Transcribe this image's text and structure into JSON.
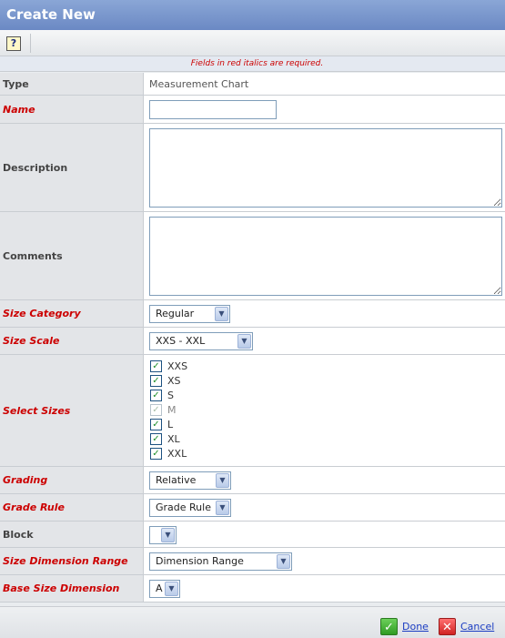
{
  "window": {
    "title": "Create New"
  },
  "toolbar": {
    "help_label": "?",
    "help_icon": "help-icon"
  },
  "required_note": "Fields in red italics are required.",
  "form": {
    "type": {
      "label": "Type",
      "value": "Measurement Chart"
    },
    "name": {
      "label": "Name",
      "value": ""
    },
    "description": {
      "label": "Description",
      "value": ""
    },
    "comments": {
      "label": "Comments",
      "value": ""
    },
    "size_category": {
      "label": "Size Category",
      "value": "Regular"
    },
    "size_scale": {
      "label": "Size Scale",
      "value": "XXS - XXL"
    },
    "select_sizes": {
      "label": "Select Sizes",
      "options": [
        {
          "label": "XXS",
          "checked": true,
          "disabled": false
        },
        {
          "label": "XS",
          "checked": true,
          "disabled": false
        },
        {
          "label": "S",
          "checked": true,
          "disabled": false
        },
        {
          "label": "M",
          "checked": true,
          "disabled": true
        },
        {
          "label": "L",
          "checked": true,
          "disabled": false
        },
        {
          "label": "XL",
          "checked": true,
          "disabled": false
        },
        {
          "label": "XXL",
          "checked": true,
          "disabled": false
        }
      ]
    },
    "grading": {
      "label": "Grading",
      "value": "Relative"
    },
    "grade_rule": {
      "label": "Grade Rule",
      "value": "Grade Rule"
    },
    "block": {
      "label": "Block",
      "value": ""
    },
    "size_dimension_range": {
      "label": "Size Dimension Range",
      "value": "Dimension Range"
    },
    "base_size_dimension": {
      "label": "Base Size Dimension",
      "value": "A"
    }
  },
  "footer": {
    "done_label": "Done",
    "cancel_label": "Cancel"
  },
  "colors": {
    "required_label": "#cc0000",
    "title_bar": "#7b97cd",
    "link": "#1a3cc2"
  }
}
